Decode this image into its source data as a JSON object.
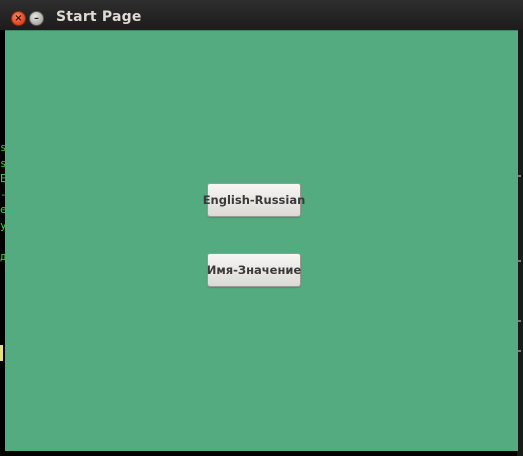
{
  "window": {
    "title": "Start Page",
    "close_glyph": "×",
    "minimize_glyph": "–"
  },
  "buttons": {
    "english_russian": "English-Russian",
    "name_value": "Имя-Значение"
  },
  "background_terminal": {
    "partial_chars": "s\ns\nE\n-\ne\ny\n\nд"
  },
  "colors": {
    "content_background": "#55ab80",
    "close_button": "#e0431c",
    "title_bar": "#2a2a2a",
    "terminal_text": "#3fd13f"
  },
  "icons": {
    "close": "close-icon",
    "minimize": "minimize-icon"
  }
}
